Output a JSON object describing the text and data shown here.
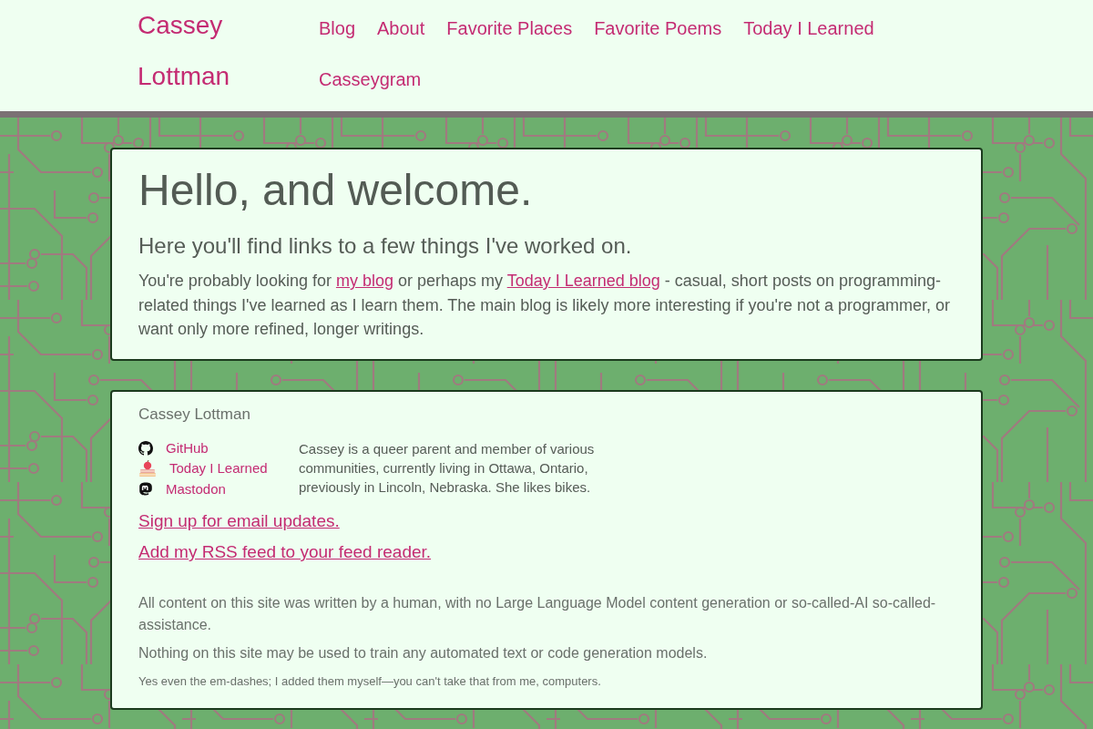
{
  "header": {
    "brand": "Cassey Lottman",
    "nav": [
      "Blog",
      "About",
      "Favorite Places",
      "Favorite Poems",
      "Today I Learned",
      "Casseygram"
    ]
  },
  "intro": {
    "title": "Hello, and welcome.",
    "subtitle": "Here you'll find links to a few things I've worked on.",
    "paragraph": [
      {
        "kind": "text",
        "text": "You're probably looking for "
      },
      {
        "kind": "link",
        "text": "my blog"
      },
      {
        "kind": "text",
        "text": " or perhaps my "
      },
      {
        "kind": "link",
        "text": "Today I Learned blog"
      },
      {
        "kind": "text",
        "text": " - casual, short posts on programming-related things I've learned as I learn them. The main blog is likely more interesting if you're not a programmer, or want only more refined, longer writings."
      }
    ]
  },
  "profile": {
    "name": "Cassey Lottman",
    "links": [
      "GitHub",
      "Today I Learned",
      "Mastodon"
    ],
    "bio": "Cassey is a queer parent and member of various communities, currently living in Ottawa, Ontario, previously in Lincoln, Nebraska. She likes bikes.",
    "actions": [
      "Sign up for email updates.",
      "Add my RSS feed to your feed reader."
    ],
    "notes": [
      {
        "kind": "note",
        "text": "All content on this site was written by a human, with no Large Language Model content generation or so-called-AI so-called-assistance."
      },
      {
        "kind": "note",
        "text": "Nothing on this site may be used to train any automated text or code generation models."
      },
      {
        "kind": "fine_print",
        "text": "Yes even the em-dashes; I added them myself—you can't take that from me, computers."
      }
    ]
  }
}
